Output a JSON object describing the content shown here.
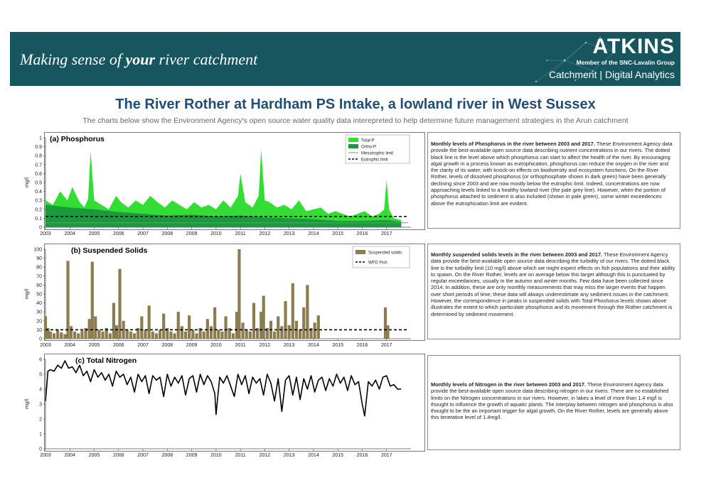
{
  "header": {
    "tagline_pre": "Making sense of ",
    "tagline_bold": "your",
    "tagline_post": " river catchment",
    "logo_text": "ATKINS",
    "member_text": "Member of the SNC-Lavalin Group",
    "division_text": "Catchment | Digital Analytics",
    "banner_color": "#17565f"
  },
  "page": {
    "title": "The River Rother at Hardham PS Intake, a lowland river in West Sussex",
    "subtitle": "The charts below show the Environment Agency's open source water quality data interepreted to help determine future management strategies in the Arun catchment"
  },
  "text_panels": [
    {
      "heading": "Monthly levels of Phosphorus in the river between 2003 and 2017.",
      "body": " These Environment Agency data provide the best-available open source data describing nutrient concentrations in our rivers. The dotted black line is the level above which phosphorus can start to affect the health of the river. By encouraging algal growth in a process known as eutrophication, phosphorus can reduce the oxygen in the river and the clarity of its water, with knock-on effects on biodiversity and ecosystem functions. On the River Rother, levels of dissolved phosphorus (or orthophosphate shown in dark green) have been generally declining since 2003 and are now mostly below the eutrophic limit. Indeed, concentrations are now approaching levels linked to a healthy lowland river (the pale grey line). However, when the portion of phosphorus attached to sediment is also included (shown in pale green), some winter exceedences above the eutrophication limit are evident."
    },
    {
      "heading": "Monthly suspended solids levels in the river between 2003 and 2017.",
      "body": " These Environment Agency data provide the best-available open source data describing the turbidity of our rivers. The dotted black line is the turbidity limit (10 mg/l) above which we might expect effects on fish populations and their ability to spawn. On the River Rother, levels are on average below this target although this is punctuated by regular exceedances, usually in the autumn and winter months. Few data have been collected since 2014. In addition, these are only monthly measurements that may miss the larger events that happen over short periods of time; these data will always underestimate any sediment issues in the catchment. However, the correspondence in peaks in suspended solids with Total Phoshorus levels shown above illustrates the extent to which particulate phosphorus and its movement through the Rother catchment is determined by sediment movement."
    },
    {
      "heading": "Monthly levels of Nitrogen in the river between 2003 and 2017.",
      "body": " These Environment Agency data provide the best-available open source data describing nitrogen in our rivers. There are no established limits on the Nitrogen concentrations in our rivers. However, in lakes a level of more than 1.4 mg/l is thought to influence the growth of aquatic plants. The interplay between nitrogen and phosphorus is also thought to be the an important trigger for algal growth. On the River Rother, levels are generally above this tenetative level of 1.4mg/l."
    }
  ],
  "chart_data": [
    {
      "type": "area",
      "title": "(a) Phosphorus",
      "ylabel": "mg/l",
      "xlabel": "",
      "xlim": [
        2003,
        2018
      ],
      "ylim": [
        0,
        1
      ],
      "y_ticks": [
        "0",
        "0.1",
        "0.2",
        "0.3",
        "0.4",
        "0.5",
        "0.6",
        "0.7",
        "0.8",
        "0.9",
        "1"
      ],
      "x_ticks": [
        "2003",
        "2004",
        "2005",
        "2006",
        "2007",
        "2008",
        "2009",
        "2010",
        "2011",
        "2012",
        "2013",
        "2014",
        "2015",
        "2016",
        "2017"
      ],
      "legend": {
        "placement": "top-right",
        "entries": [
          "Total-P",
          "Ortho-P",
          "Mesotrophic limit",
          "Eutrophic limit"
        ]
      },
      "colors": {
        "total_p": "#33dd33",
        "ortho_p": "#1a9a3c",
        "mesotrophic": "#888888",
        "eutrophic": "#000000"
      },
      "reference_lines": [
        {
          "name": "Mesotrophic limit",
          "y": 0.05
        },
        {
          "name": "Eutrophic limit",
          "y": 0.12
        }
      ],
      "series": [
        {
          "name": "Total-P",
          "x": [
            2003.0,
            2003.3,
            2003.6,
            2003.9,
            2004.1,
            2004.4,
            2004.6,
            2004.75,
            2004.85,
            2005.0,
            2005.3,
            2005.6,
            2005.9,
            2006.1,
            2006.4,
            2006.7,
            2007.0,
            2007.3,
            2007.6,
            2007.9,
            2008.2,
            2008.5,
            2008.8,
            2009.1,
            2009.4,
            2009.7,
            2010.0,
            2010.3,
            2010.6,
            2010.9,
            2011.0,
            2011.2,
            2011.5,
            2011.75,
            2011.85,
            2012.0,
            2012.2,
            2012.5,
            2012.8,
            2013.1,
            2013.4,
            2013.7,
            2014.0,
            2014.3,
            2014.6,
            2014.9,
            2015.2,
            2015.5,
            2015.8,
            2016.1,
            2016.4,
            2016.7,
            2016.9,
            2017.0,
            2017.1,
            2017.3,
            2017.6
          ],
          "values": [
            0.3,
            0.25,
            0.4,
            0.3,
            0.45,
            0.28,
            0.22,
            0.32,
            0.85,
            0.3,
            0.25,
            0.2,
            0.35,
            0.28,
            0.22,
            0.3,
            0.25,
            0.35,
            0.28,
            0.22,
            0.3,
            0.25,
            0.2,
            0.28,
            0.22,
            0.25,
            0.2,
            0.3,
            0.22,
            0.35,
            0.6,
            0.28,
            0.22,
            0.35,
            0.87,
            0.3,
            0.28,
            0.22,
            0.25,
            0.2,
            0.3,
            0.18,
            0.2,
            0.22,
            0.15,
            0.18,
            0.15,
            0.12,
            0.15,
            0.18,
            0.12,
            0.15,
            0.2,
            0.53,
            0.2,
            0.1,
            0.08
          ]
        },
        {
          "name": "Ortho-P",
          "x": [
            2003.0,
            2004.0,
            2005.0,
            2006.0,
            2007.0,
            2008.0,
            2009.0,
            2010.0,
            2011.0,
            2012.0,
            2013.0,
            2014.0,
            2015.0,
            2016.0,
            2017.0,
            2017.6
          ],
          "values": [
            0.25,
            0.22,
            0.2,
            0.17,
            0.15,
            0.13,
            0.14,
            0.12,
            0.13,
            0.11,
            0.1,
            0.09,
            0.07,
            0.07,
            0.08,
            0.06
          ]
        }
      ]
    },
    {
      "type": "bar",
      "title": "(b) Suspended Solids",
      "ylabel": "mg/l",
      "xlabel": "",
      "xlim": [
        2003,
        2018
      ],
      "ylim": [
        0,
        100
      ],
      "y_ticks": [
        "0",
        "10",
        "20",
        "30",
        "40",
        "50",
        "60",
        "70",
        "80",
        "90",
        "100"
      ],
      "x_ticks": [
        "2003",
        "2004",
        "2005",
        "2006",
        "2007",
        "2008",
        "2009",
        "2010",
        "2011",
        "2012",
        "2013",
        "2014",
        "2015",
        "2016",
        "2017"
      ],
      "legend": {
        "placement": "top-right",
        "entries": [
          "Suspended solids",
          "WFD Fish"
        ]
      },
      "colors": {
        "bars": "#8b7d50",
        "wfd": "#000000"
      },
      "reference_lines": [
        {
          "name": "WFD Fish",
          "y": 10
        }
      ],
      "series": [
        {
          "name": "Suspended solids",
          "x": [
            2003.0,
            2003.1,
            2003.2,
            2003.35,
            2003.5,
            2003.65,
            2003.8,
            2003.92,
            2004.05,
            2004.2,
            2004.35,
            2004.5,
            2004.65,
            2004.8,
            2004.92,
            2005.05,
            2005.2,
            2005.35,
            2005.5,
            2005.65,
            2005.8,
            2005.92,
            2006.05,
            2006.2,
            2006.35,
            2006.5,
            2006.65,
            2006.8,
            2006.95,
            2007.1,
            2007.25,
            2007.4,
            2007.55,
            2007.7,
            2007.85,
            2008.0,
            2008.15,
            2008.3,
            2008.45,
            2008.6,
            2008.75,
            2008.9,
            2009.05,
            2009.2,
            2009.35,
            2009.5,
            2009.65,
            2009.8,
            2009.95,
            2010.1,
            2010.25,
            2010.4,
            2010.55,
            2010.7,
            2010.85,
            2010.95,
            2011.1,
            2011.25,
            2011.4,
            2011.55,
            2011.7,
            2011.85,
            2011.95,
            2012.1,
            2012.25,
            2012.4,
            2012.55,
            2012.7,
            2012.85,
            2013.0,
            2013.15,
            2013.3,
            2013.45,
            2013.6,
            2013.75,
            2013.9,
            2014.05,
            2014.2,
            2016.95,
            2017.05
          ],
          "values": [
            25,
            12,
            8,
            6,
            10,
            7,
            5,
            87,
            14,
            8,
            6,
            9,
            12,
            22,
            86,
            25,
            10,
            8,
            12,
            6,
            40,
            15,
            78,
            20,
            10,
            8,
            6,
            12,
            25,
            10,
            37,
            8,
            6,
            10,
            28,
            12,
            8,
            6,
            30,
            14,
            8,
            26,
            10,
            6,
            12,
            8,
            22,
            14,
            35,
            10,
            8,
            25,
            12,
            6,
            30,
            100,
            18,
            10,
            8,
            40,
            12,
            30,
            48,
            12,
            20,
            8,
            25,
            14,
            42,
            15,
            62,
            20,
            10,
            35,
            60,
            12,
            18,
            26,
            35,
            15
          ]
        }
      ]
    },
    {
      "type": "line",
      "title": "(c) Total Nitrogen",
      "ylabel": "mg/l",
      "xlabel": "",
      "xlim": [
        2003,
        2018
      ],
      "ylim": [
        0,
        6
      ],
      "y_ticks": [
        "0",
        "1",
        "2",
        "3",
        "4",
        "5",
        "6"
      ],
      "x_ticks": [
        "2003",
        "2004",
        "2005",
        "2006",
        "2007",
        "2008",
        "2009",
        "2010",
        "2011",
        "2012",
        "2013",
        "2014",
        "2015",
        "2016",
        "2017"
      ],
      "colors": {
        "line": "#000000"
      },
      "series": [
        {
          "name": "",
          "x": [
            2003.0,
            2003.1,
            2003.2,
            2003.35,
            2003.5,
            2003.65,
            2003.8,
            2003.95,
            2004.1,
            2004.25,
            2004.4,
            2004.55,
            2004.7,
            2004.85,
            2005.0,
            2005.15,
            2005.3,
            2005.45,
            2005.6,
            2005.75,
            2005.9,
            2006.05,
            2006.2,
            2006.35,
            2006.5,
            2006.65,
            2006.8,
            2006.95,
            2007.1,
            2007.25,
            2007.4,
            2007.55,
            2007.7,
            2007.85,
            2008.0,
            2008.15,
            2008.3,
            2008.45,
            2008.6,
            2008.75,
            2008.9,
            2009.05,
            2009.2,
            2009.35,
            2009.5,
            2009.65,
            2009.8,
            2009.95,
            2010.0,
            2010.15,
            2010.3,
            2010.45,
            2010.6,
            2010.75,
            2010.9,
            2011.05,
            2011.2,
            2011.35,
            2011.5,
            2011.65,
            2011.8,
            2011.95,
            2012.1,
            2012.25,
            2012.4,
            2012.55,
            2012.7,
            2012.85,
            2013.0,
            2013.15,
            2013.3,
            2013.45,
            2013.6,
            2013.75,
            2013.9,
            2014.05,
            2014.2,
            2014.35,
            2014.5,
            2014.65,
            2014.8,
            2014.95,
            2015.1,
            2015.25,
            2015.4,
            2015.55,
            2015.7,
            2015.85,
            2016.0,
            2016.1,
            2016.25,
            2016.4,
            2016.55,
            2016.7,
            2016.85,
            2017.0,
            2017.15,
            2017.3,
            2017.45,
            2017.6
          ],
          "values": [
            3.2,
            5.2,
            5.3,
            5.2,
            5.6,
            5.4,
            5.9,
            5.4,
            5.5,
            5.1,
            5.6,
            4.9,
            5.2,
            4.5,
            5.3,
            4.8,
            5.1,
            4.6,
            5.0,
            4.2,
            5.2,
            4.8,
            5.0,
            4.3,
            4.8,
            3.8,
            5.0,
            4.5,
            4.9,
            3.7,
            4.9,
            4.6,
            4.8,
            3.5,
            5.0,
            4.2,
            4.8,
            4.4,
            4.9,
            3.6,
            4.7,
            4.9,
            3.8,
            5.0,
            4.3,
            4.9,
            4.5,
            3.7,
            2.3,
            4.8,
            4.4,
            4.9,
            4.2,
            3.5,
            5.0,
            4.3,
            4.9,
            3.7,
            4.8,
            4.4,
            4.7,
            3.6,
            5.0,
            4.4,
            3.2,
            4.7,
            2.5,
            4.6,
            4.9,
            3.6,
            4.8,
            3.3,
            4.7,
            4.0,
            4.9,
            3.8,
            4.6,
            4.8,
            3.9,
            4.7,
            4.2,
            5.0,
            4.4,
            4.8,
            3.9,
            4.9,
            4.3,
            4.5,
            3.0,
            2.2,
            4.5,
            4.2,
            4.6,
            4.0,
            4.8,
            4.9,
            4.2,
            4.3,
            4.0,
            4.0
          ]
        }
      ]
    }
  ]
}
